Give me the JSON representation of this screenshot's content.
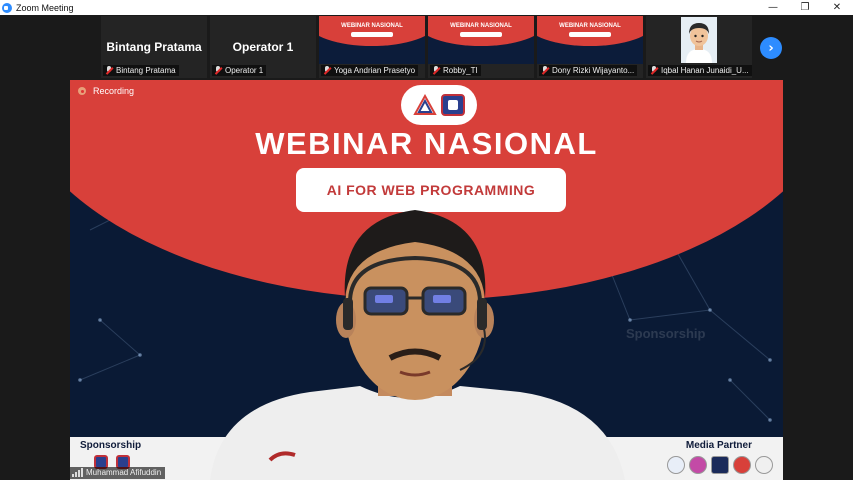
{
  "window": {
    "title": "Zoom Meeting",
    "controls": [
      "minimize",
      "restore",
      "close"
    ]
  },
  "participants_strip": {
    "tiles": [
      {
        "big_name": "Bintang Pratama",
        "label": "Bintang Pratama",
        "muted": true,
        "video": false
      },
      {
        "big_name": "Operator 1",
        "label": "Operator 1",
        "muted": true,
        "video": false
      },
      {
        "label": "Yoga Andrian Prasetyo",
        "muted": true,
        "video": true,
        "thumbnail_text": "WEBINAR NASIONAL"
      },
      {
        "label": "Robby_TI",
        "muted": true,
        "video": true,
        "thumbnail_text": "WEBINAR NASIONAL"
      },
      {
        "label": "Dony Rizki Wijayanto...",
        "muted": true,
        "video": true,
        "thumbnail_text": "WEBINAR NASIONAL"
      },
      {
        "label": "Iqbal Hanan Junaidi_U...",
        "muted": true,
        "video": false,
        "avatar": true
      }
    ],
    "next_icon": "chevron-right-icon"
  },
  "main_video": {
    "recording_label": "Recording",
    "banner_title": "WEBINAR NASIONAL",
    "banner_subtitle": "AI FOR WEB PROGRAMMING",
    "faint_text": "Sponsorship",
    "footer_left": "Sponsorship",
    "footer_right": "Media Partner",
    "speaker_name": "Muhammad Afifuddin",
    "colors": {
      "banner_red": "#d8403a",
      "background_navy": "#0a1a35",
      "accent_blue": "#2d8cff"
    }
  }
}
